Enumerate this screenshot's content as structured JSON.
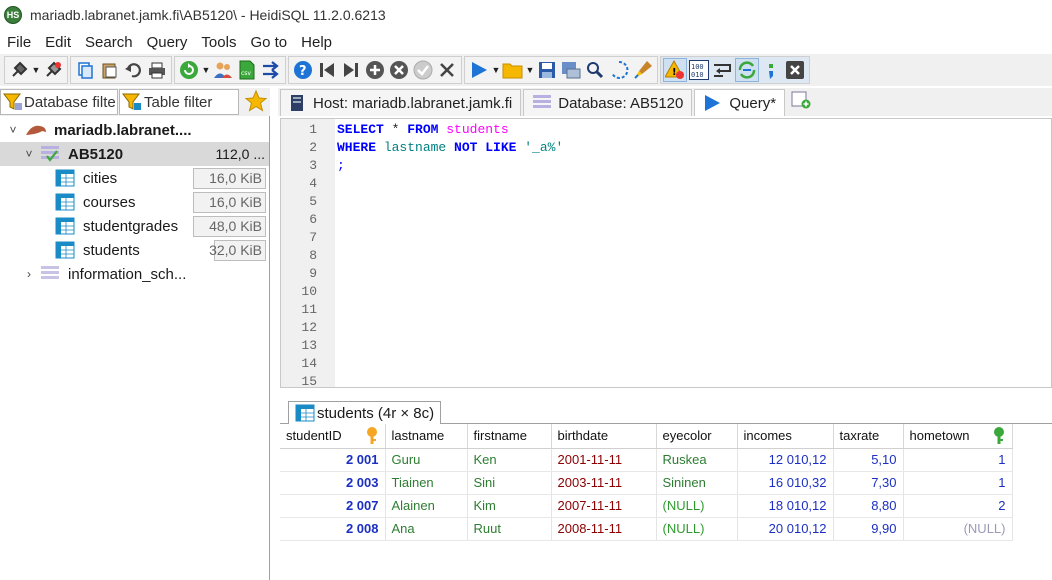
{
  "window": {
    "title": "mariadb.labranet.jamk.fi\\AB5120\\ - HeidiSQL 11.2.0.6213"
  },
  "menu": [
    "File",
    "Edit",
    "Search",
    "Query",
    "Tools",
    "Go to",
    "Help"
  ],
  "filters": {
    "database_placeholder": "Database filte",
    "table_placeholder": "Table filter"
  },
  "tree": {
    "host": "mariadb.labranet....",
    "database": {
      "name": "AB5120",
      "size": "112,0 ..."
    },
    "tables": [
      {
        "name": "cities",
        "size": "16,0 KiB"
      },
      {
        "name": "courses",
        "size": "16,0 KiB"
      },
      {
        "name": "studentgrades",
        "size": "48,0 KiB"
      },
      {
        "name": "students",
        "size": "32,0 KiB"
      }
    ],
    "other_db": "information_sch..."
  },
  "tabs": {
    "host": "Host: mariadb.labranet.jamk.fi",
    "database": "Database: AB5120",
    "query": "Query*"
  },
  "editor": {
    "line_numbers": [
      "1",
      "2",
      "3",
      "4",
      "5",
      "6",
      "7",
      "8",
      "9",
      "10",
      "11",
      "12",
      "13",
      "14",
      "15"
    ],
    "line1": {
      "kw1": "SELECT",
      "star": " * ",
      "kw2": "FROM",
      "table": " students"
    },
    "line2": {
      "kw1": "WHERE",
      "field": " lastname ",
      "kw2": "NOT LIKE",
      "str": " '_a%'"
    },
    "line3": ";"
  },
  "result": {
    "tab_label": "students (4r × 8c)",
    "columns": [
      "studentID",
      "lastname",
      "firstname",
      "birthdate",
      "eyecolor",
      "incomes",
      "taxrate",
      "hometown"
    ],
    "rows": [
      [
        "2 001",
        "Guru",
        "Ken",
        "2001-11-11",
        "Ruskea",
        "12 010,12",
        "5,10",
        "1"
      ],
      [
        "2 003",
        "Tiainen",
        "Sini",
        "2003-11-11",
        "Sininen",
        "16 010,32",
        "7,30",
        "1"
      ],
      [
        "2 007",
        "Alainen",
        "Kim",
        "2007-11-11",
        "(NULL)",
        "18 010,12",
        "8,80",
        "2"
      ],
      [
        "2 008",
        "Ana",
        "Ruut",
        "2008-11-11",
        "(NULL)",
        "20 010,12",
        "9,90",
        "(NULL)"
      ]
    ]
  },
  "colors": {
    "key_orange": "#f5a623",
    "key_green": "#3aa83a",
    "play_blue": "#1e74d6"
  }
}
